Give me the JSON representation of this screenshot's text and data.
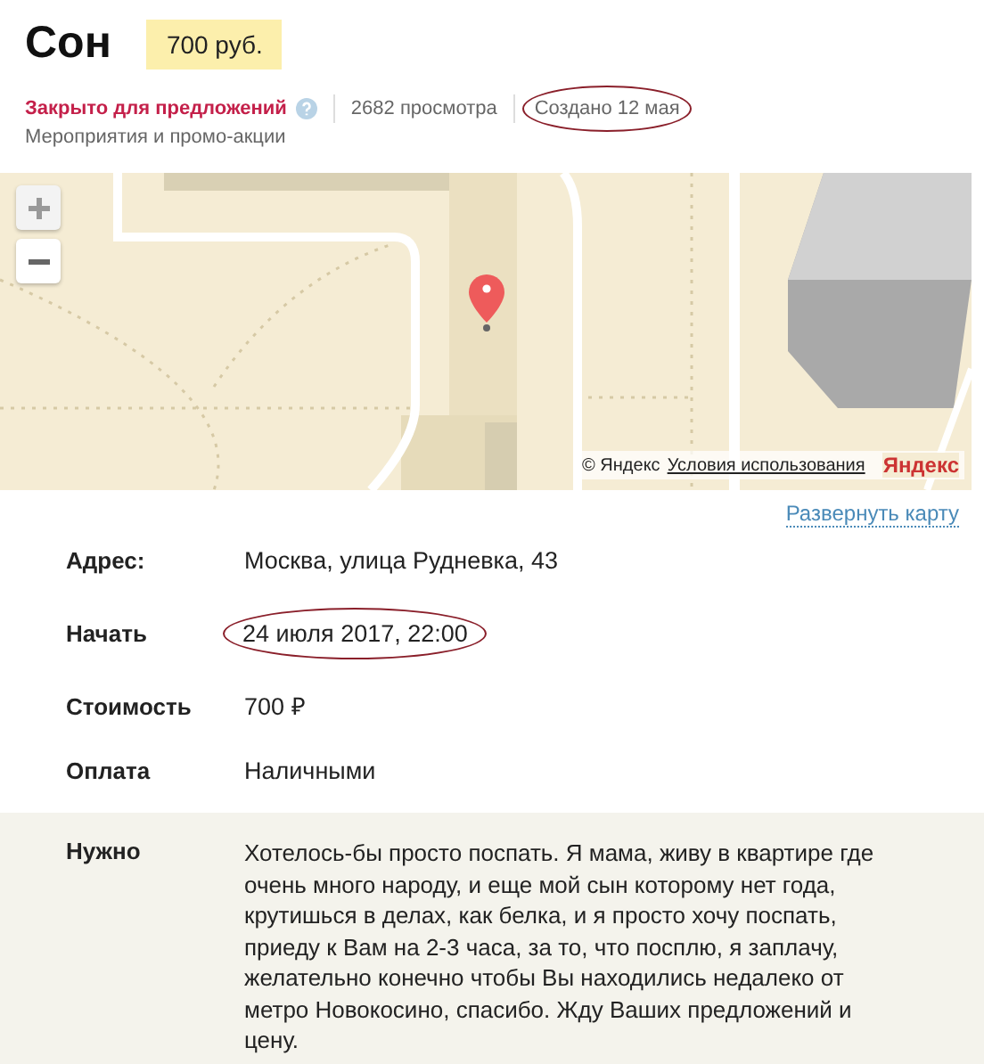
{
  "title": "Сон",
  "price": "700 руб.",
  "status": {
    "text": "Закрыто для предложений",
    "help": true
  },
  "views": "2682 просмотра",
  "created": {
    "text": "Создано 12 мая",
    "circled": true
  },
  "category": "Мероприятия и промо-акции",
  "map": {
    "kind": "picture",
    "attribution": "© Яндекс",
    "terms": "Условия использования",
    "logo": "Яндекс",
    "expand": "Развернуть карту"
  },
  "details": [
    {
      "label": "Адрес:",
      "value": "Москва, улица Рудневка, 43",
      "circled": false
    },
    {
      "label": "Начать",
      "value": "24 июля 2017, 22:00",
      "circled": true
    },
    {
      "label": "Стоимость",
      "value": "700 ₽",
      "circled": false
    },
    {
      "label": "Оплата",
      "value": "Наличными",
      "circled": false
    }
  ],
  "need": {
    "label": "Нужно",
    "text": "Хотелось-бы просто поспать. Я мама, живу в квартире где очень много народу, и еще мой сын которому нет года, крутишься в делах, как белка, и я просто хочу поспать, приеду к Вам на 2-3 часа, за то, что посплю, я заплачу, желательно конечно чтобы Вы находились недалеко от метро Новокосино, спасибо. Жду Ваших предложений и цену."
  }
}
